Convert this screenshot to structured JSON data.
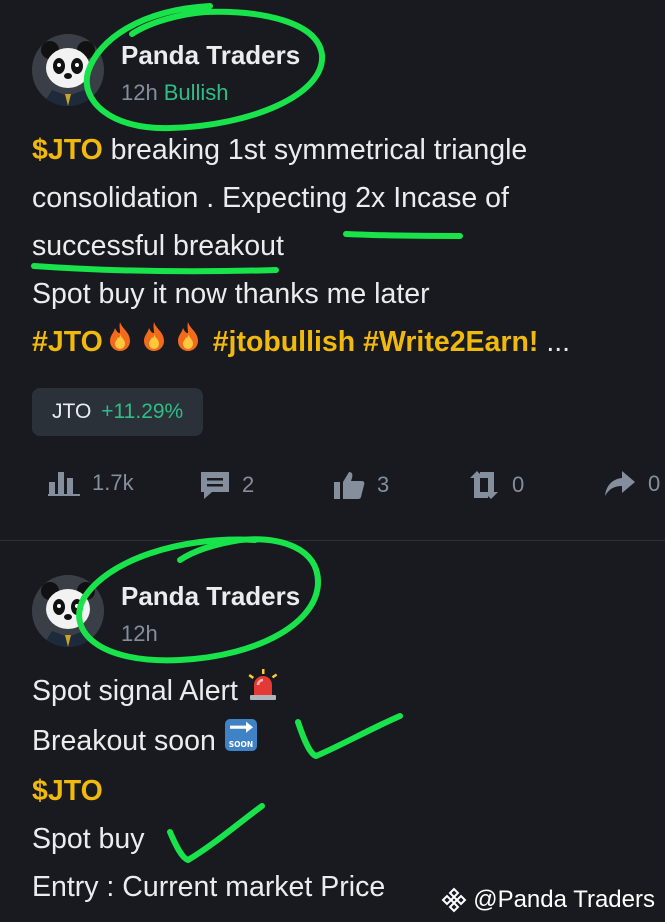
{
  "posts": [
    {
      "author": "Panda Traders",
      "time": "12h",
      "sentiment": "Bullish",
      "lines": {
        "l1_tag": "$JTO",
        "l1_text": " breaking 1st symmetrical triangle",
        "l2": "consolidation . Expecting 2x Incase of",
        "l3": "successful breakout",
        "l4": "Spot buy it now thanks me later",
        "l5_tag1": "#JTO",
        "l5_tag2": "#jtobullish",
        "l5_tag3": "#Write2Earn!",
        "l5_more": " ..."
      },
      "coin": {
        "symbol": "JTO",
        "change": "+11.29%"
      },
      "actions": {
        "views": "1.7k",
        "comments": "2",
        "likes": "3",
        "reposts": "0",
        "shares": "0"
      }
    },
    {
      "author": "Panda Traders",
      "time": "12h",
      "lines": {
        "l1": "Spot signal Alert ",
        "l2": "Breakout soon ",
        "l3_tag": "$JTO",
        "l4": "Spot buy",
        "l5": "Entry : Current market Price"
      }
    }
  ],
  "watermark": "@Panda Traders",
  "icons": {
    "views": "bar-chart-icon",
    "comments": "comment-icon",
    "likes": "thumbs-up-icon",
    "reposts": "repost-icon",
    "shares": "share-icon",
    "fire": "fire-emoji",
    "siren": "siren-emoji",
    "soon": "soon-arrow-emoji",
    "brand": "binance-logo-icon"
  },
  "colors": {
    "background": "#181a20",
    "text": "#eaecef",
    "muted": "#848e9c",
    "brand": "#f0b90b",
    "positive": "#2ebd85",
    "highlighter": "#19e34a"
  }
}
